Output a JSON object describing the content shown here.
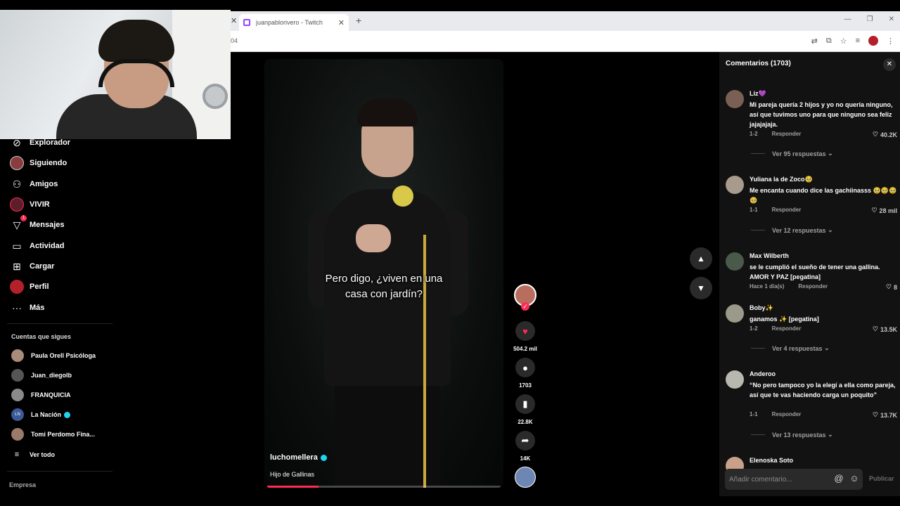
{
  "browser": {
    "tab_title": "juanpablorivero - Twitch",
    "url_fragment": "04"
  },
  "nav": {
    "items": [
      {
        "label": "Explorador",
        "icon": "compass-icon"
      },
      {
        "label": "Siguiendo",
        "icon": "avatar-icon"
      },
      {
        "label": "Amigos",
        "icon": "friends-icon"
      },
      {
        "label": "VIVIR",
        "icon": "live-avatar-icon"
      },
      {
        "label": "Mensajes",
        "icon": "send-icon",
        "badge": "1"
      },
      {
        "label": "Actividad",
        "icon": "activity-icon"
      },
      {
        "label": "Cargar",
        "icon": "upload-icon"
      },
      {
        "label": "Perfil",
        "icon": "profile-icon"
      },
      {
        "label": "Más",
        "icon": "more-icon"
      }
    ],
    "following_title": "Cuentas que sigues",
    "following": [
      {
        "name": "Paula Orell Psicóloga",
        "verified": false
      },
      {
        "name": "Juan_diegolb",
        "verified": false
      },
      {
        "name": "FRANQUICIA",
        "verified": false
      },
      {
        "name": "La Nación",
        "verified": true,
        "avatar_text": "LN"
      },
      {
        "name": "Tomi Perdomo Fina...",
        "verified": false
      }
    ],
    "see_all": "Ver todo",
    "company": "Empresa"
  },
  "video": {
    "caption": "Pero digo, ¿viven en una\ncasa con jardín?",
    "author": "luchomellera",
    "author_verified": true,
    "description": "Hijo de Gallinas",
    "progress_fraction": 0.22
  },
  "actions": {
    "likes": "504.2 mil",
    "comments": "1703",
    "saves": "22.8K",
    "shares": "14K"
  },
  "comments_panel": {
    "title": "Comentarios (1703)",
    "input_placeholder": "Añadir comentario...",
    "publish_label": "Publicar",
    "reply_label": "Responder",
    "items": [
      {
        "user": "Liz💜",
        "text": "Mi pareja quería 2 hijos y yo no quería ninguno, así que tuvimos uno para que ninguno sea feliz jajajajaja.",
        "date": "1-2",
        "likes": "40.2K",
        "replies": "Ver 95 respuestas"
      },
      {
        "user": "Yuliana la de Zoco🥹",
        "text": "Me encanta cuando dice las gachiinasss 🥹🥹🥹🥹",
        "date": "1-1",
        "likes": "28 mil",
        "replies": "Ver 12 respuestas"
      },
      {
        "user": "Max Wilberth",
        "text": "se le cumplió el sueño de tener una gallina. AMOR Y PAZ [pegatina]",
        "date": "Hace 1 día(s)",
        "likes": "8",
        "replies": ""
      },
      {
        "user": "Boby✨",
        "text": "ganamos ✨ [pegatina]",
        "date": "1-2",
        "likes": "13.5K",
        "replies": "Ver 4 respuestas"
      },
      {
        "user": "Anderoo",
        "text": "“No pero tampoco yo la elegí a ella como pareja, así que te vas haciendo carga un poquito”",
        "date": "1-1",
        "likes": "13.7K",
        "replies": "Ver 13 respuestas"
      },
      {
        "user": "Elenoska Soto",
        "text": "",
        "date": "",
        "likes": "",
        "replies": ""
      }
    ]
  },
  "colors": {
    "accent": "#fe2c55",
    "verified": "#20d5ec",
    "panel_bg": "#121212"
  }
}
